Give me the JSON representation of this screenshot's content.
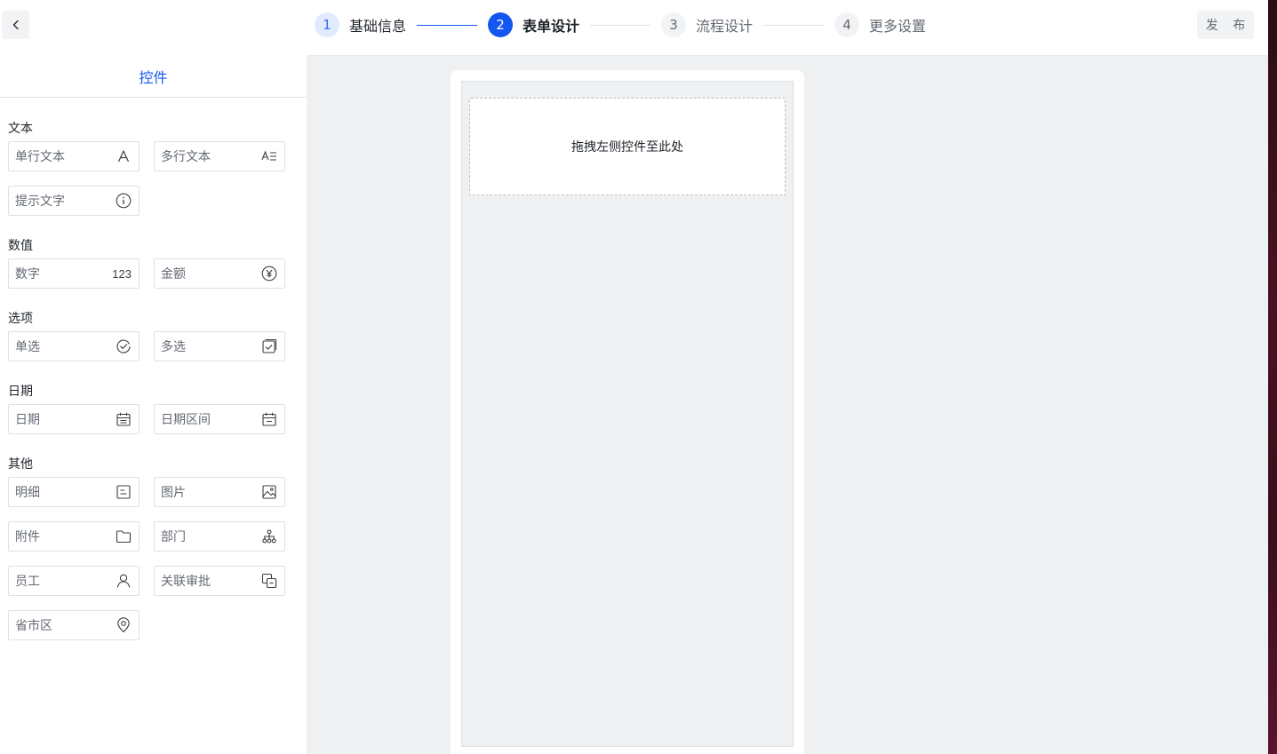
{
  "header": {
    "back_icon": "chevron-left-icon",
    "steps": [
      {
        "num": "1",
        "label": "基础信息",
        "state": "done"
      },
      {
        "num": "2",
        "label": "表单设计",
        "state": "active"
      },
      {
        "num": "3",
        "label": "流程设计",
        "state": "todo"
      },
      {
        "num": "4",
        "label": "更多设置",
        "state": "todo"
      }
    ],
    "publish_label": "发 布"
  },
  "sidebar": {
    "tab_label": "控件",
    "groups": [
      {
        "title": "文本",
        "items": [
          {
            "label": "单行文本",
            "icon": "letter-a-icon"
          },
          {
            "label": "多行文本",
            "icon": "multiline-text-icon"
          },
          {
            "label": "提示文字",
            "icon": "info-icon"
          }
        ]
      },
      {
        "title": "数值",
        "items": [
          {
            "label": "数字",
            "icon_text": "123"
          },
          {
            "label": "金额",
            "icon": "yen-icon"
          }
        ]
      },
      {
        "title": "选项",
        "items": [
          {
            "label": "单选",
            "icon": "check-circle-icon"
          },
          {
            "label": "多选",
            "icon": "check-square-icon"
          }
        ]
      },
      {
        "title": "日期",
        "items": [
          {
            "label": "日期",
            "icon": "calendar-icon"
          },
          {
            "label": "日期区间",
            "icon": "calendar-range-icon"
          }
        ]
      },
      {
        "title": "其他",
        "items": [
          {
            "label": "明细",
            "icon": "detail-icon"
          },
          {
            "label": "图片",
            "icon": "image-icon"
          },
          {
            "label": "附件",
            "icon": "folder-icon"
          },
          {
            "label": "部门",
            "icon": "org-tree-icon"
          },
          {
            "label": "员工",
            "icon": "user-icon"
          },
          {
            "label": "关联审批",
            "icon": "link-copy-icon"
          },
          {
            "label": "省市区",
            "icon": "location-icon"
          }
        ]
      }
    ]
  },
  "canvas": {
    "drop_hint": "拖拽左侧控件至此处"
  },
  "colors": {
    "primary": "#1456f0",
    "step_done_bg": "#e1eaff",
    "canvas_bg": "#eff0f2"
  }
}
